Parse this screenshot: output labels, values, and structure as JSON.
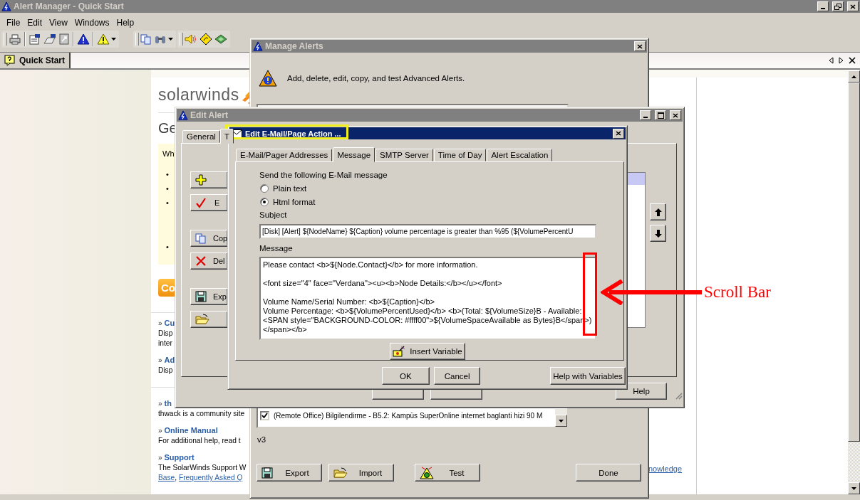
{
  "window": {
    "title": "Alert Manager - Quick Start"
  },
  "menu": [
    "File",
    "Edit",
    "View",
    "Windows",
    "Help"
  ],
  "tabs": [
    {
      "label": "Quick Start",
      "selected": true
    }
  ],
  "start_page": {
    "logo": "solarwinds",
    "heading": "Ge",
    "intro": "Wh",
    "bullets": [
      "•",
      "•",
      "•",
      "•"
    ],
    "action": "Co",
    "sections": [
      {
        "marker": "»",
        "title": "Cu",
        "lines": [
          "Disp",
          "inter"
        ]
      },
      {
        "marker": "»",
        "title": "Ad",
        "lines": [
          "Disp"
        ]
      },
      {
        "marker": "»",
        "title": "th",
        "lines": [
          "thwack is a community site"
        ]
      },
      {
        "marker": "»",
        "title": "Online Manual",
        "lines": [
          "For additional help, read t"
        ]
      },
      {
        "marker": "»",
        "title": "Support",
        "lines": [
          "The SolarWinds Support W"
        ]
      }
    ],
    "support_links": [
      {
        "kind": "link",
        "text": "Base"
      },
      {
        "kind": "text",
        "text": ","
      },
      {
        "kind": "link",
        "text": "Frequently Asked Q"
      }
    ],
    "right_link": "nowledge"
  },
  "manage_alerts": {
    "title": "Manage Alerts",
    "description": "Add, delete, edit, copy, and test Advanced Alerts.",
    "alerts": [
      {
        "checked": true,
        "name": "(Remote Office) Bilgilendirme - B5.2: Kampüs SuperOnline internet baglanti hizi 90 M"
      }
    ],
    "version": "v3",
    "buttons": [
      {
        "kind": "export",
        "label": "Export"
      },
      {
        "kind": "import",
        "label": "Import"
      },
      {
        "kind": "test",
        "label": "Test"
      },
      {
        "kind": "done",
        "label": "Done"
      }
    ]
  },
  "edit_alert": {
    "title": "Edit Alert",
    "tabs": [
      {
        "label": "General",
        "selected": false
      },
      {
        "label": "T",
        "selected": true
      }
    ],
    "actions": [
      {
        "kind": "add"
      },
      {
        "kind": "edit",
        "label": "E"
      },
      {
        "kind": "copy",
        "label": "Cop"
      },
      {
        "kind": "delete",
        "label": "Del"
      },
      {
        "kind": "export",
        "label": "Exp"
      },
      {
        "kind": "import"
      }
    ],
    "help": "Help"
  },
  "email_dialog": {
    "title": "Edit E-Mail/Page Action ...",
    "tabs": [
      {
        "label": "E-Mail/Pager Addresses",
        "selected": false
      },
      {
        "label": "Message",
        "selected": true
      },
      {
        "label": "SMTP Server",
        "selected": false
      },
      {
        "label": "Time of Day",
        "selected": false
      },
      {
        "label": "Alert Escalation",
        "selected": false
      }
    ],
    "intro": "Send the following E-Mail message",
    "formats": [
      {
        "label": "Plain text",
        "selected": false
      },
      {
        "label": "Html format",
        "selected": true
      }
    ],
    "subject_label": "Subject",
    "subject": "[Disk] [Alert] ${NodeName} ${Caption} volume percentage is greater than %95 (${VolumePercentU",
    "message_label": "Message",
    "message": "Please contact <b>${Node.Contact}</b> for more information.\n\n<font size=\"4\" face=\"Verdana\"><u><b>Node Details:</b></u></font>\n\nVolume Name/Serial Number: <b>${Caption}</b>\nVolume Percentage: <b>${VolumePercentUsed}</b> <b>(Total: ${VolumeSize}B - Available:\n<SPAN style=\"BACKGROUND-COLOR: #ffff00\">${VolumeSpaceAvailable as Bytes}B</span>)\n</span></b>",
    "insert_button": "Insert Variable",
    "buttons": [
      "OK",
      "Cancel",
      "Help with Variables"
    ]
  },
  "annotation": {
    "label": "Scroll Bar"
  }
}
